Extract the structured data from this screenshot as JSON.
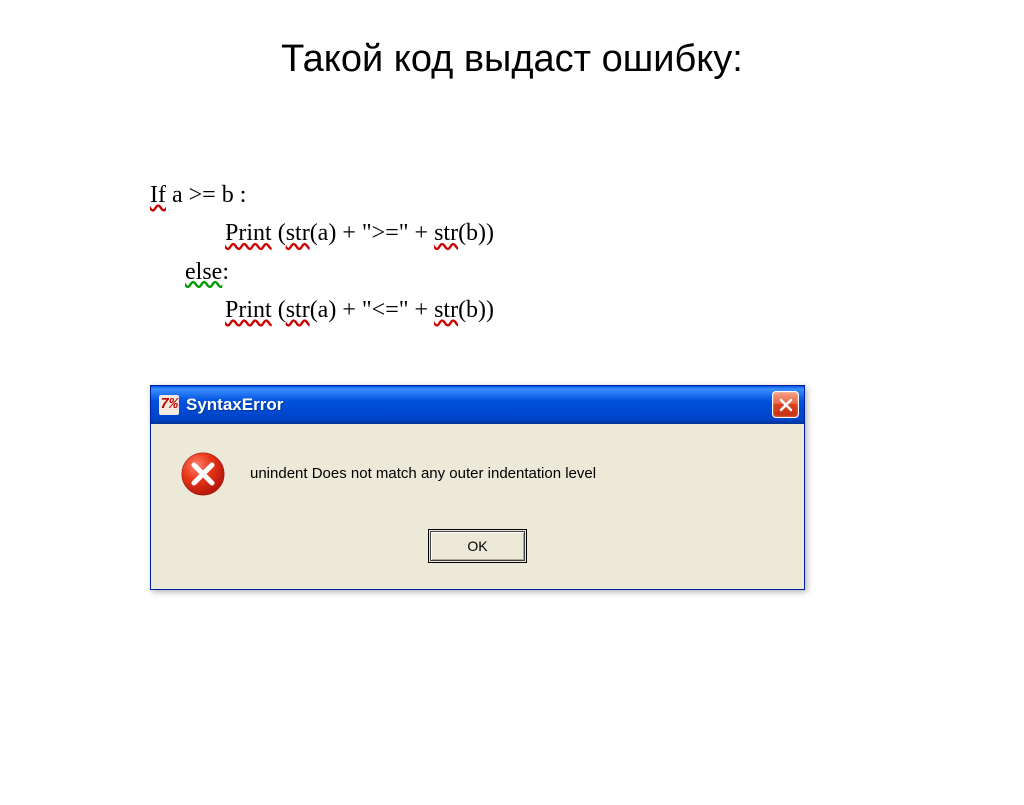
{
  "slide": {
    "title": "Такой код выдаст ошибку:"
  },
  "code": {
    "line1": "If a >= b :",
    "line2": "Print (str(a) + \">=\" + str(b))",
    "line3": "else:",
    "line4": "Print (str(a) + \"<=\" + str(b))"
  },
  "dialog": {
    "titlebar_icon": "7%",
    "title": "SyntaxError",
    "message": "unindent Does not match any outer indentation level",
    "ok_label": "OK"
  }
}
